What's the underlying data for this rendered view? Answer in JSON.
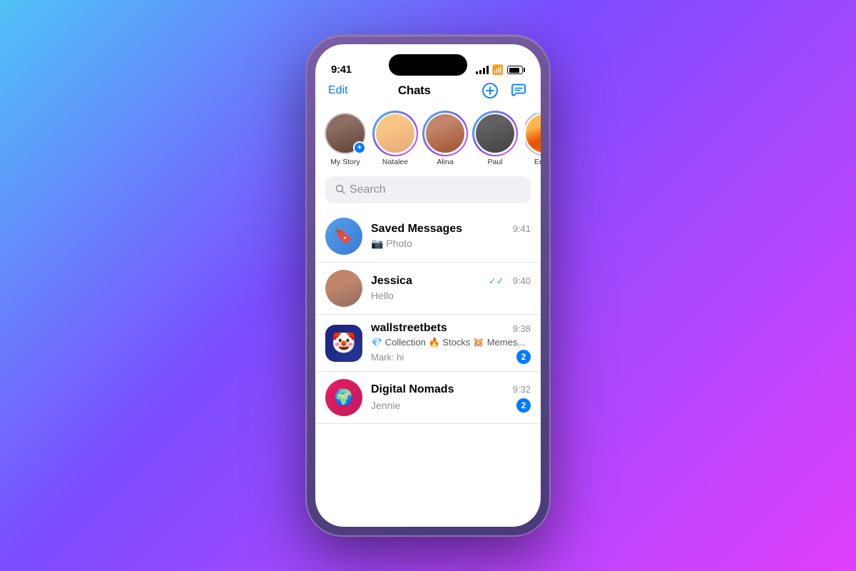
{
  "background": {
    "gradient": "linear-gradient(135deg, #4fc3f7 0%, #7c4dff 40%, #e040fb 100%)"
  },
  "statusBar": {
    "time": "9:41"
  },
  "header": {
    "edit": "Edit",
    "title": "Chats"
  },
  "stories": [
    {
      "id": "my-story",
      "label": "My Story",
      "isOwn": true
    },
    {
      "id": "natalee",
      "label": "Natalee"
    },
    {
      "id": "alina",
      "label": "Alina"
    },
    {
      "id": "paul",
      "label": "Paul"
    },
    {
      "id": "emma",
      "label": "Emma"
    }
  ],
  "search": {
    "placeholder": "Search"
  },
  "chats": [
    {
      "id": "saved",
      "name": "Saved Messages",
      "preview": "📷 Photo",
      "time": "9:41",
      "type": "saved"
    },
    {
      "id": "jessica",
      "name": "Jessica",
      "preview": "Hello",
      "time": "9:40",
      "hasDoubleCheck": true,
      "type": "personal"
    },
    {
      "id": "wsb",
      "name": "wallstreetbets",
      "topicTags": "💎 Collection 🔥 Stocks 🐹 Memes...",
      "preview2": "Mark: hi",
      "time": "9:38",
      "unread": 2,
      "type": "group"
    },
    {
      "id": "digital-nomads",
      "name": "Digital Nomads",
      "preview": "Jennie",
      "time": "9:32",
      "unread": 2,
      "type": "group"
    }
  ]
}
